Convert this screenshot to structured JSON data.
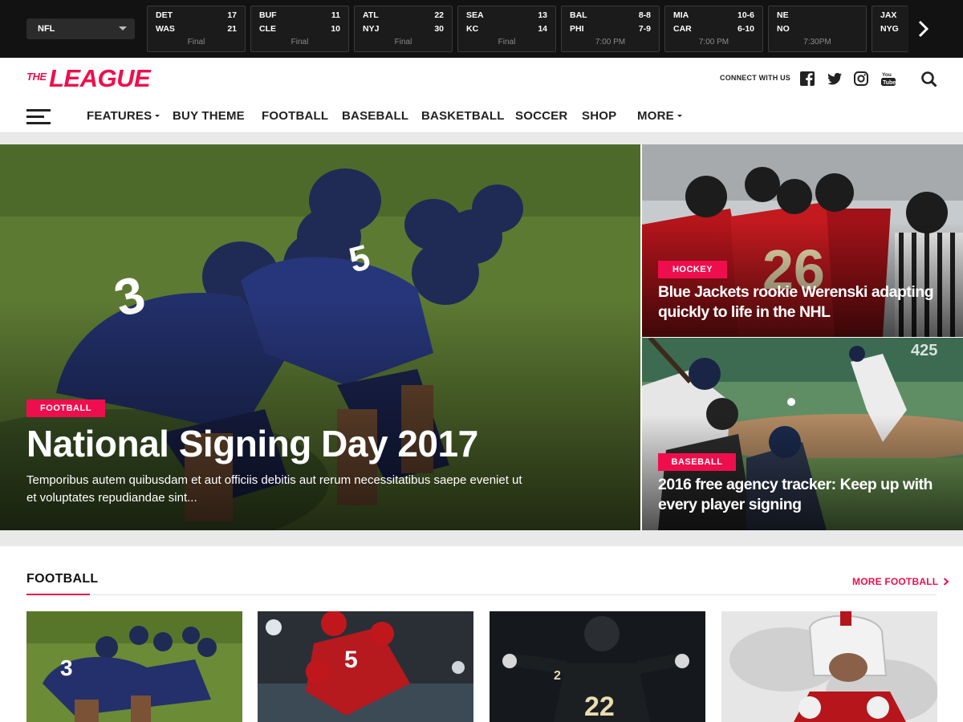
{
  "scores": {
    "league": "NFL",
    "games": [
      {
        "team1": "DET",
        "score1": "17",
        "team2": "WAS",
        "score2": "21",
        "status": "Final"
      },
      {
        "team1": "BUF",
        "score1": "11",
        "team2": "CLE",
        "score2": "10",
        "status": "Final"
      },
      {
        "team1": "ATL",
        "score1": "22",
        "team2": "NYJ",
        "score2": "30",
        "status": "Final"
      },
      {
        "team1": "SEA",
        "score1": "13",
        "team2": "KC",
        "score2": "14",
        "status": "Final"
      },
      {
        "team1": "BAL",
        "score1": "8-8",
        "team2": "PHI",
        "score2": "7-9",
        "status": "7:00 PM"
      },
      {
        "team1": "MIA",
        "score1": "10-6",
        "team2": "CAR",
        "score2": "6-10",
        "status": "7:00 PM"
      },
      {
        "team1": "NE",
        "score1": "",
        "team2": "NO",
        "score2": "",
        "status": "7:30PM"
      },
      {
        "team1": "JAX",
        "score1": "",
        "team2": "NYG",
        "score2": "",
        "status": ""
      }
    ],
    "next_icon": "chevron-right-icon"
  },
  "header": {
    "logo_the": "THE",
    "logo_league": "LEAGUE",
    "connect_label": "CONNECT WITH US",
    "social_icons": [
      "facebook-icon",
      "twitter-icon",
      "instagram-icon",
      "youtube-icon"
    ],
    "search_icon": "search-icon",
    "accent": "#ef0e4d"
  },
  "nav": {
    "menu_icon": "hamburger-icon",
    "items": [
      {
        "label": "FEATURES",
        "dropdown": true
      },
      {
        "label": "BUY THEME",
        "dropdown": false
      },
      {
        "label": "FOOTBALL",
        "dropdown": false
      },
      {
        "label": "BASEBALL",
        "dropdown": false
      },
      {
        "label": "BASKETBALL",
        "dropdown": false
      },
      {
        "label": "SOCCER",
        "dropdown": false
      },
      {
        "label": "SHOP",
        "dropdown": false
      },
      {
        "label": "MORE",
        "dropdown": true
      }
    ]
  },
  "hero": {
    "main": {
      "category": "FOOTBALL",
      "title": "National Signing Day 2017",
      "excerpt": "Temporibus autem quibusdam et aut officiis debitis aut rerum necessitatibus saepe eveniet ut et voluptates repudiandae sint..."
    },
    "side": [
      {
        "category": "HOCKEY",
        "title": "Blue Jackets rookie Werenski adapting quickly to life in the NHL"
      },
      {
        "category": "BASEBALL",
        "title": "2016 free agency tracker: Keep up with every player signing"
      }
    ]
  },
  "football_section": {
    "title": "FOOTBALL",
    "more_label": "MORE FOOTBALL",
    "more_icon": "chevron-right-icon"
  }
}
